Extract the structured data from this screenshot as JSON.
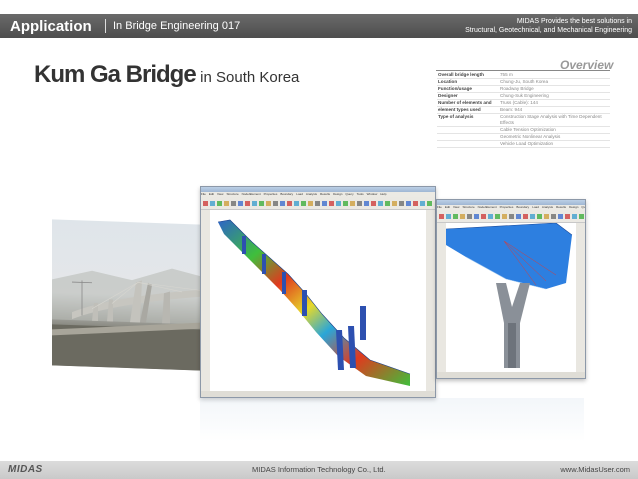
{
  "header": {
    "title": "Application",
    "subtitle": "In Bridge Engineering 017",
    "tagline_line1": "MIDAS Provides the best solutions in",
    "tagline_line2": "Structural, Geotechnical, and Mechanical Engineering"
  },
  "bridge": {
    "name": "Kum Ga Bridge",
    "location": "in South Korea"
  },
  "overview": {
    "title": "Overview",
    "rows": [
      {
        "key": "Overall bridge length",
        "value": "755 m"
      },
      {
        "key": "Location",
        "value": "Chung-Ju, South Korea"
      },
      {
        "key": "Function/usage",
        "value": "Roadway Bridge"
      },
      {
        "key": "Designer",
        "value": "Chung-Suk Engineering"
      },
      {
        "key": "Number of elements and",
        "value": "Truss (Cable): 144"
      },
      {
        "key": "element types used",
        "value": "Beam: 944"
      },
      {
        "key": "Type of analysis",
        "value": "Construction Stage Analysis with Time Dependent Effects"
      },
      {
        "key": "",
        "value": "Cable Tension Optimization"
      },
      {
        "key": "",
        "value": "Geometric Nonlinear Analysis"
      },
      {
        "key": "",
        "value": "Vehicle Load Optimization"
      }
    ]
  },
  "software": {
    "menu": [
      "File",
      "Edit",
      "View",
      "Structure",
      "Node/Element",
      "Properties",
      "Boundary",
      "Load",
      "Analysis",
      "Results",
      "Design",
      "Query",
      "Tools",
      "Window",
      "Help"
    ]
  },
  "footer": {
    "logo": "MIDAS",
    "company": "MIDAS Information Technology Co., Ltd.",
    "url": "www.MidasUser.com"
  },
  "colors": {
    "header_bg": "#595959",
    "footer_bg": "#d0d0d0",
    "model_blue": "#2d64c8",
    "model_red": "#e03a1e",
    "model_green": "#3fbf3c"
  }
}
